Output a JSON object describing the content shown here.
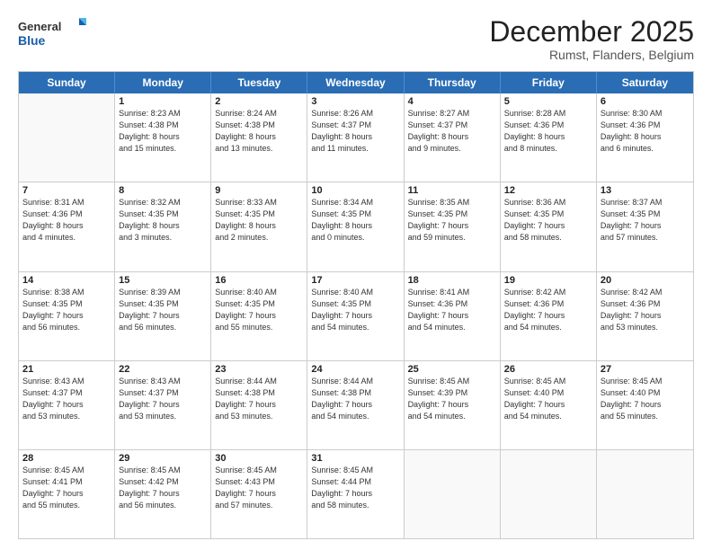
{
  "logo": {
    "line1": "General",
    "line2": "Blue"
  },
  "title": "December 2025",
  "location": "Rumst, Flanders, Belgium",
  "days_of_week": [
    "Sunday",
    "Monday",
    "Tuesday",
    "Wednesday",
    "Thursday",
    "Friday",
    "Saturday"
  ],
  "weeks": [
    [
      {
        "day": "",
        "info": ""
      },
      {
        "day": "1",
        "info": "Sunrise: 8:23 AM\nSunset: 4:38 PM\nDaylight: 8 hours\nand 15 minutes."
      },
      {
        "day": "2",
        "info": "Sunrise: 8:24 AM\nSunset: 4:38 PM\nDaylight: 8 hours\nand 13 minutes."
      },
      {
        "day": "3",
        "info": "Sunrise: 8:26 AM\nSunset: 4:37 PM\nDaylight: 8 hours\nand 11 minutes."
      },
      {
        "day": "4",
        "info": "Sunrise: 8:27 AM\nSunset: 4:37 PM\nDaylight: 8 hours\nand 9 minutes."
      },
      {
        "day": "5",
        "info": "Sunrise: 8:28 AM\nSunset: 4:36 PM\nDaylight: 8 hours\nand 8 minutes."
      },
      {
        "day": "6",
        "info": "Sunrise: 8:30 AM\nSunset: 4:36 PM\nDaylight: 8 hours\nand 6 minutes."
      }
    ],
    [
      {
        "day": "7",
        "info": "Sunrise: 8:31 AM\nSunset: 4:36 PM\nDaylight: 8 hours\nand 4 minutes."
      },
      {
        "day": "8",
        "info": "Sunrise: 8:32 AM\nSunset: 4:35 PM\nDaylight: 8 hours\nand 3 minutes."
      },
      {
        "day": "9",
        "info": "Sunrise: 8:33 AM\nSunset: 4:35 PM\nDaylight: 8 hours\nand 2 minutes."
      },
      {
        "day": "10",
        "info": "Sunrise: 8:34 AM\nSunset: 4:35 PM\nDaylight: 8 hours\nand 0 minutes."
      },
      {
        "day": "11",
        "info": "Sunrise: 8:35 AM\nSunset: 4:35 PM\nDaylight: 7 hours\nand 59 minutes."
      },
      {
        "day": "12",
        "info": "Sunrise: 8:36 AM\nSunset: 4:35 PM\nDaylight: 7 hours\nand 58 minutes."
      },
      {
        "day": "13",
        "info": "Sunrise: 8:37 AM\nSunset: 4:35 PM\nDaylight: 7 hours\nand 57 minutes."
      }
    ],
    [
      {
        "day": "14",
        "info": "Sunrise: 8:38 AM\nSunset: 4:35 PM\nDaylight: 7 hours\nand 56 minutes."
      },
      {
        "day": "15",
        "info": "Sunrise: 8:39 AM\nSunset: 4:35 PM\nDaylight: 7 hours\nand 56 minutes."
      },
      {
        "day": "16",
        "info": "Sunrise: 8:40 AM\nSunset: 4:35 PM\nDaylight: 7 hours\nand 55 minutes."
      },
      {
        "day": "17",
        "info": "Sunrise: 8:40 AM\nSunset: 4:35 PM\nDaylight: 7 hours\nand 54 minutes."
      },
      {
        "day": "18",
        "info": "Sunrise: 8:41 AM\nSunset: 4:36 PM\nDaylight: 7 hours\nand 54 minutes."
      },
      {
        "day": "19",
        "info": "Sunrise: 8:42 AM\nSunset: 4:36 PM\nDaylight: 7 hours\nand 54 minutes."
      },
      {
        "day": "20",
        "info": "Sunrise: 8:42 AM\nSunset: 4:36 PM\nDaylight: 7 hours\nand 53 minutes."
      }
    ],
    [
      {
        "day": "21",
        "info": "Sunrise: 8:43 AM\nSunset: 4:37 PM\nDaylight: 7 hours\nand 53 minutes."
      },
      {
        "day": "22",
        "info": "Sunrise: 8:43 AM\nSunset: 4:37 PM\nDaylight: 7 hours\nand 53 minutes."
      },
      {
        "day": "23",
        "info": "Sunrise: 8:44 AM\nSunset: 4:38 PM\nDaylight: 7 hours\nand 53 minutes."
      },
      {
        "day": "24",
        "info": "Sunrise: 8:44 AM\nSunset: 4:38 PM\nDaylight: 7 hours\nand 54 minutes."
      },
      {
        "day": "25",
        "info": "Sunrise: 8:45 AM\nSunset: 4:39 PM\nDaylight: 7 hours\nand 54 minutes."
      },
      {
        "day": "26",
        "info": "Sunrise: 8:45 AM\nSunset: 4:40 PM\nDaylight: 7 hours\nand 54 minutes."
      },
      {
        "day": "27",
        "info": "Sunrise: 8:45 AM\nSunset: 4:40 PM\nDaylight: 7 hours\nand 55 minutes."
      }
    ],
    [
      {
        "day": "28",
        "info": "Sunrise: 8:45 AM\nSunset: 4:41 PM\nDaylight: 7 hours\nand 55 minutes."
      },
      {
        "day": "29",
        "info": "Sunrise: 8:45 AM\nSunset: 4:42 PM\nDaylight: 7 hours\nand 56 minutes."
      },
      {
        "day": "30",
        "info": "Sunrise: 8:45 AM\nSunset: 4:43 PM\nDaylight: 7 hours\nand 57 minutes."
      },
      {
        "day": "31",
        "info": "Sunrise: 8:45 AM\nSunset: 4:44 PM\nDaylight: 7 hours\nand 58 minutes."
      },
      {
        "day": "",
        "info": ""
      },
      {
        "day": "",
        "info": ""
      },
      {
        "day": "",
        "info": ""
      }
    ]
  ]
}
